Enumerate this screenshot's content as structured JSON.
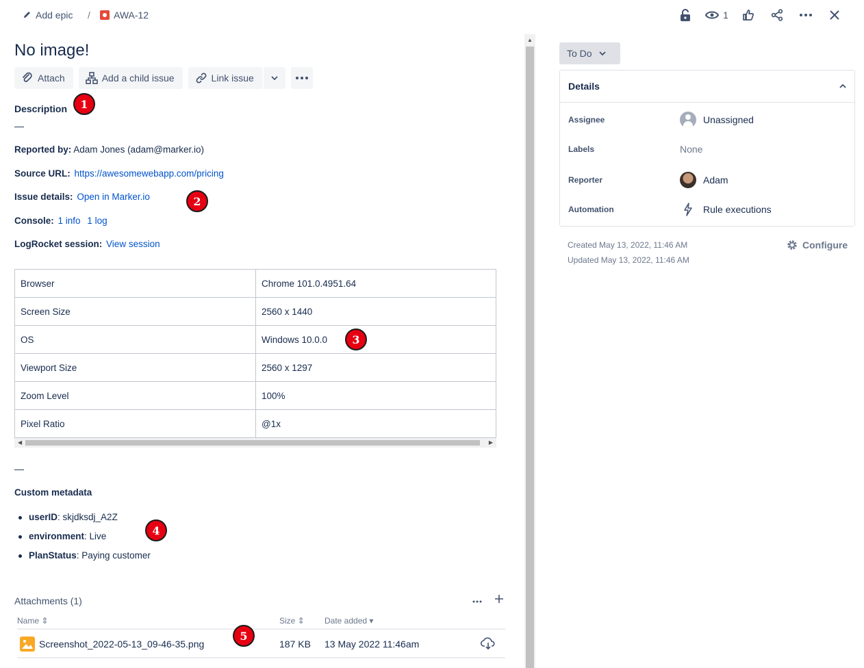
{
  "breadcrumb": {
    "epic_label": "Add epic",
    "separator": "/",
    "issue_key": "AWA-12"
  },
  "top_actions": {
    "watch_count": "1"
  },
  "issue": {
    "title": "No image!"
  },
  "toolbar": {
    "attach": "Attach",
    "add_child": "Add a child issue",
    "link_issue": "Link issue"
  },
  "description": {
    "heading": "Description",
    "dash": "—",
    "reported_by_label": "Reported by:",
    "reported_by_value": " Adam Jones (adam@marker.io)",
    "source_url_label": "Source URL:",
    "source_url_value": "https://awesomewebapp.com/pricing",
    "issue_details_label": "Issue details:",
    "issue_details_link": "Open in Marker.io",
    "console_label": "Console:",
    "console_info": "1 info",
    "console_log": "1 log",
    "logrocket_label": "LogRocket session:",
    "logrocket_link": "View session"
  },
  "env_table": [
    [
      "Browser",
      "Chrome 101.0.4951.64"
    ],
    [
      "Screen Size",
      "2560 x 1440"
    ],
    [
      "OS",
      "Windows 10.0.0"
    ],
    [
      "Viewport Size",
      "2560 x 1297"
    ],
    [
      "Zoom Level",
      "100%"
    ],
    [
      "Pixel Ratio",
      "@1x"
    ]
  ],
  "custom_metadata": {
    "heading": "Custom metadata",
    "items": [
      {
        "key": "userID",
        "value": ": skjdksdj_A2Z"
      },
      {
        "key": "environment",
        "value": ": Live"
      },
      {
        "key": "PlanStatus",
        "value": ": Paying customer"
      }
    ]
  },
  "attachments": {
    "heading": "Attachments (1)",
    "col_name": "Name",
    "col_size": "Size",
    "col_date": "Date added",
    "rows": [
      {
        "name": "Screenshot_2022-05-13_09-46-35.png",
        "size": "187 KB",
        "date": "13 May 2022 11:46am"
      }
    ]
  },
  "status": {
    "label": "To Do"
  },
  "details": {
    "heading": "Details",
    "assignee_label": "Assignee",
    "assignee_value": "Unassigned",
    "labels_label": "Labels",
    "labels_value": "None",
    "reporter_label": "Reporter",
    "reporter_value": "Adam",
    "automation_label": "Automation",
    "automation_value": "Rule executions"
  },
  "dates": {
    "created": "Created May 13, 2022, 11:46 AM",
    "updated": "Updated May 13, 2022, 11:46 AM"
  },
  "configure_label": "Configure",
  "markers": [
    "1",
    "2",
    "3",
    "4",
    "5"
  ],
  "colors": {
    "link": "#0052cc",
    "marker": "#e60012",
    "text": "#172b4d"
  }
}
